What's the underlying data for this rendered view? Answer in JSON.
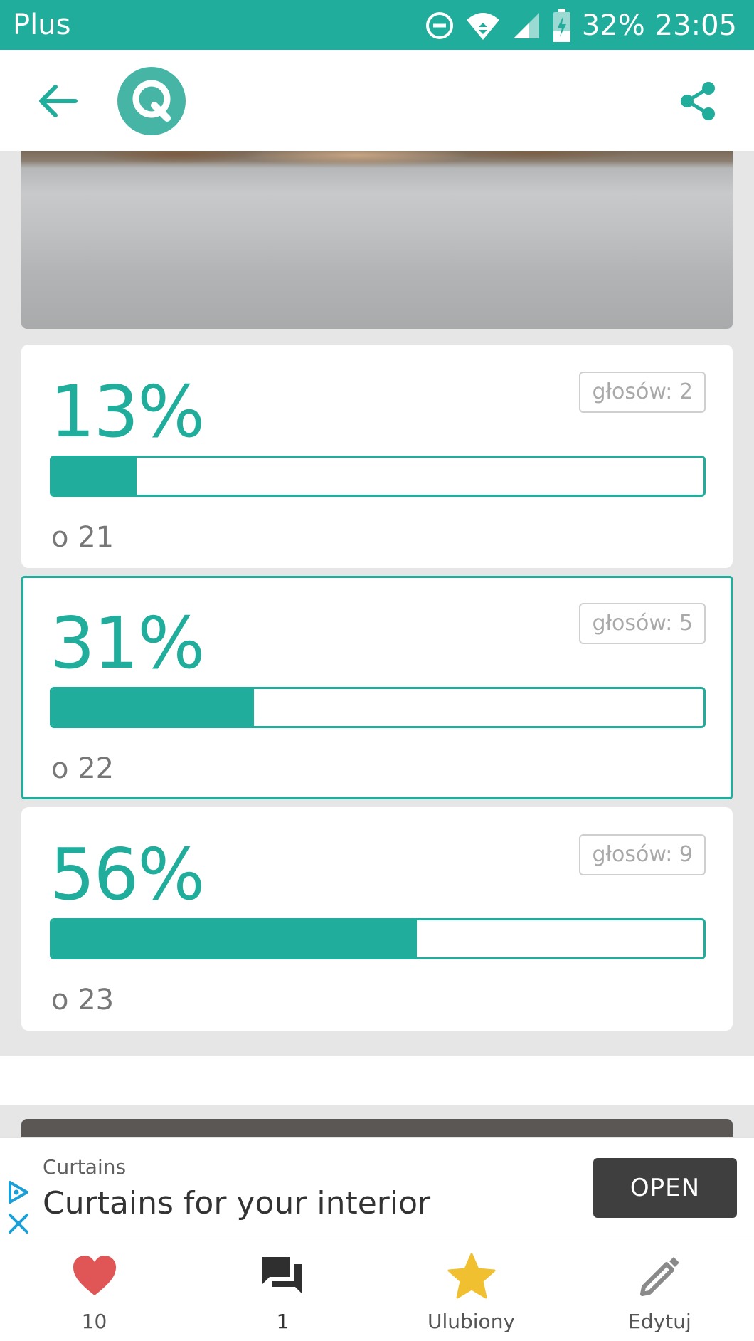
{
  "status_bar": {
    "carrier": "Plus",
    "battery": "32%",
    "time": "23:05",
    "icons": [
      "do-not-disturb-icon",
      "wifi-icon",
      "signal-icon",
      "battery-charging-icon"
    ]
  },
  "app_bar": {
    "back_icon": "arrow-back-icon",
    "logo_letter": "Q",
    "share_icon": "share-icon"
  },
  "colors": {
    "accent": "#20ad9c",
    "heart": "#e05555",
    "star": "#f0c030",
    "ad_button": "#3f3f3f"
  },
  "poll": {
    "options": [
      {
        "percent_label": "13%",
        "percent": 13,
        "votes_label": "głosów: 2",
        "option_label": "o 21",
        "selected": false
      },
      {
        "percent_label": "31%",
        "percent": 31,
        "votes_label": "głosów: 5",
        "option_label": "o 22",
        "selected": true
      },
      {
        "percent_label": "56%",
        "percent": 56,
        "votes_label": "głosów: 9",
        "option_label": "o 23",
        "selected": false
      }
    ]
  },
  "ad": {
    "advertiser": "Curtains",
    "headline": "Curtains for your interior",
    "button": "OPEN"
  },
  "bottom_nav": {
    "items": [
      {
        "label": "10",
        "icon": "heart-icon"
      },
      {
        "label": "1",
        "icon": "comments-icon"
      },
      {
        "label": "Ulubiony",
        "icon": "star-icon"
      },
      {
        "label": "Edytuj",
        "icon": "pencil-icon"
      }
    ]
  }
}
